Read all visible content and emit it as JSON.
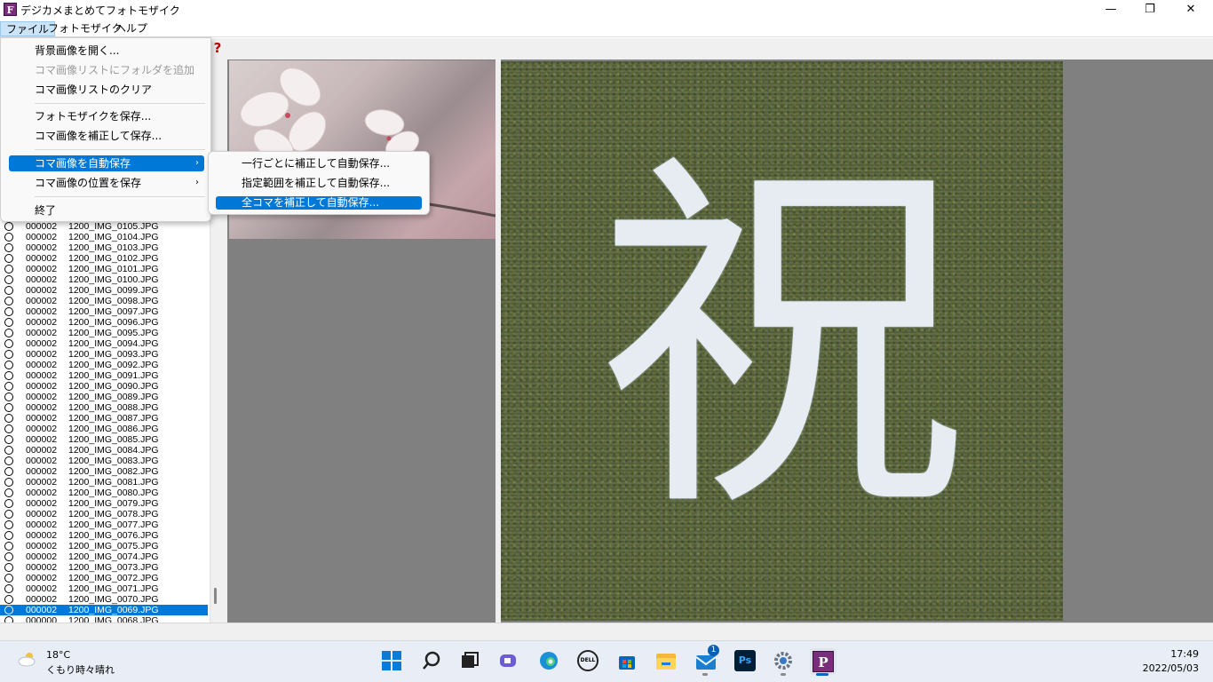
{
  "window": {
    "title": "デジカメまとめてフォトモザイク",
    "app_icon_letter": "F",
    "minimize": "—",
    "maximize": "❐",
    "close": "✕"
  },
  "menubar": {
    "items": [
      "ファイル",
      "フォトモザイク",
      "ヘルプ"
    ]
  },
  "toolbar": {
    "help_icon": "?"
  },
  "file_menu": {
    "items": [
      {
        "label": "背景画像を開く...",
        "disabled": false
      },
      {
        "label": "コマ画像リストにフォルダを追加",
        "disabled": true
      },
      {
        "label": "コマ画像リストのクリア",
        "disabled": false
      },
      {
        "label": "フォトモザイクを保存...",
        "disabled": false
      },
      {
        "label": "コマ画像を補正して保存...",
        "disabled": false
      },
      {
        "label": "コマ画像を自動保存",
        "disabled": false,
        "highlighted": true,
        "submenu": true
      },
      {
        "label": "コマ画像の位置を保存",
        "disabled": false,
        "submenu": true
      },
      {
        "label": "終了",
        "disabled": false
      }
    ],
    "submenu_arrow": "›"
  },
  "auto_save_submenu": {
    "items": [
      {
        "label": "一行ごとに補正して自動保存..."
      },
      {
        "label": "指定範囲を補正して自動保存..."
      },
      {
        "label": "全コマを補正して自動保存...",
        "highlighted": true
      }
    ]
  },
  "image_list": {
    "rows": [
      {
        "num": "000002",
        "file": "1200_IMG_0105.JPG"
      },
      {
        "num": "000002",
        "file": "1200_IMG_0104.JPG"
      },
      {
        "num": "000002",
        "file": "1200_IMG_0103.JPG"
      },
      {
        "num": "000002",
        "file": "1200_IMG_0102.JPG"
      },
      {
        "num": "000002",
        "file": "1200_IMG_0101.JPG"
      },
      {
        "num": "000002",
        "file": "1200_IMG_0100.JPG"
      },
      {
        "num": "000002",
        "file": "1200_IMG_0099.JPG"
      },
      {
        "num": "000002",
        "file": "1200_IMG_0098.JPG"
      },
      {
        "num": "000002",
        "file": "1200_IMG_0097.JPG"
      },
      {
        "num": "000002",
        "file": "1200_IMG_0096.JPG"
      },
      {
        "num": "000002",
        "file": "1200_IMG_0095.JPG"
      },
      {
        "num": "000002",
        "file": "1200_IMG_0094.JPG"
      },
      {
        "num": "000002",
        "file": "1200_IMG_0093.JPG"
      },
      {
        "num": "000002",
        "file": "1200_IMG_0092.JPG"
      },
      {
        "num": "000002",
        "file": "1200_IMG_0091.JPG"
      },
      {
        "num": "000002",
        "file": "1200_IMG_0090.JPG"
      },
      {
        "num": "000002",
        "file": "1200_IMG_0089.JPG"
      },
      {
        "num": "000002",
        "file": "1200_IMG_0088.JPG"
      },
      {
        "num": "000002",
        "file": "1200_IMG_0087.JPG"
      },
      {
        "num": "000002",
        "file": "1200_IMG_0086.JPG"
      },
      {
        "num": "000002",
        "file": "1200_IMG_0085.JPG"
      },
      {
        "num": "000002",
        "file": "1200_IMG_0084.JPG"
      },
      {
        "num": "000002",
        "file": "1200_IMG_0083.JPG"
      },
      {
        "num": "000002",
        "file": "1200_IMG_0082.JPG"
      },
      {
        "num": "000002",
        "file": "1200_IMG_0081.JPG"
      },
      {
        "num": "000002",
        "file": "1200_IMG_0080.JPG"
      },
      {
        "num": "000002",
        "file": "1200_IMG_0079.JPG"
      },
      {
        "num": "000002",
        "file": "1200_IMG_0078.JPG"
      },
      {
        "num": "000002",
        "file": "1200_IMG_0077.JPG"
      },
      {
        "num": "000002",
        "file": "1200_IMG_0076.JPG"
      },
      {
        "num": "000002",
        "file": "1200_IMG_0075.JPG"
      },
      {
        "num": "000002",
        "file": "1200_IMG_0074.JPG"
      },
      {
        "num": "000002",
        "file": "1200_IMG_0073.JPG"
      },
      {
        "num": "000002",
        "file": "1200_IMG_0072.JPG"
      },
      {
        "num": "000002",
        "file": "1200_IMG_0071.JPG"
      },
      {
        "num": "000002",
        "file": "1200_IMG_0070.JPG"
      },
      {
        "num": "000002",
        "file": "1200_IMG_0069.JPG",
        "selected": true
      },
      {
        "num": "000000",
        "file": "1200_IMG_0068.JPG"
      }
    ]
  },
  "mosaic": {
    "character": "祝"
  },
  "taskbar": {
    "weather_temp": "18°C",
    "weather_desc": "くもり時々晴れ",
    "icons": [
      "windows-start-icon",
      "search-icon",
      "task-view-icon",
      "chat-icon",
      "edge-icon",
      "dell-icon",
      "store-icon",
      "file-explorer-icon",
      "mail-icon",
      "photoshop-icon",
      "settings-icon",
      "photomosaic-app-icon"
    ],
    "mail_badge": "1",
    "ps_label": "Ps",
    "dell_label": "DELL",
    "app_label": "P",
    "clock_time": "17:49",
    "clock_date": "2022/05/03"
  },
  "colors": {
    "accent": "#0078d7",
    "app_purple": "#7a2d7a",
    "pane_gray": "#808080"
  }
}
